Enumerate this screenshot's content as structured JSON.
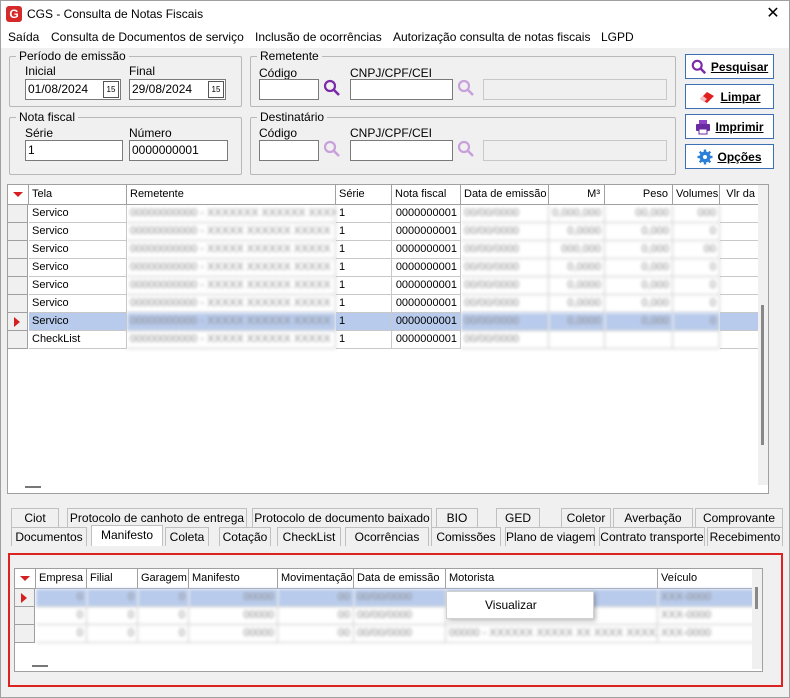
{
  "window": {
    "title": "CGS - Consulta de Notas Fiscais",
    "close": "✕",
    "icon": "G"
  },
  "menu": [
    "Saída",
    "Consulta de Documentos de serviço",
    "Inclusão de ocorrências",
    "Autorização consulta de notas fiscais",
    "LGPD"
  ],
  "periodo": {
    "title": "Período de emissão",
    "inicial_label": "Inicial",
    "inicial_value": "01/08/2024",
    "final_label": "Final",
    "final_value": "29/08/2024",
    "cal_text": "15"
  },
  "remetente": {
    "title": "Remetente",
    "codigo_label": "Código",
    "cnpj_label": "CNPJ/CPF/CEI"
  },
  "nota": {
    "title": "Nota fiscal",
    "serie_label": "Série",
    "serie_value": "1",
    "numero_label": "Número",
    "numero_value": "0000000001"
  },
  "destinatario": {
    "title": "Destinatário",
    "codigo_label": "Código",
    "cnpj_label": "CNPJ/CPF/CEI"
  },
  "buttons": {
    "pesquisar": "Pesquisar",
    "limpar": "Limpar",
    "imprimir": "Imprimir",
    "opcoes": "Opções"
  },
  "grid1": {
    "columns": [
      "Tela",
      "Remetente",
      "Série",
      "Nota fiscal",
      "Data de emissão",
      "M³",
      "Peso",
      "Volumes",
      "Vlr da"
    ],
    "rows": [
      {
        "tela": "Servico",
        "rem": "00000000000 - XXXXXXX XXXXXX XXXXX",
        "serie": "1",
        "nf": "0000000001",
        "data": "00/00/0000",
        "m3": "0,000,000",
        "peso": "00,000",
        "vol": "000"
      },
      {
        "tela": "Servico",
        "rem": "00000000000 - XXXXX XXXXXX XXXXX",
        "serie": "1",
        "nf": "0000000001",
        "data": "00/00/0000",
        "m3": "0,0000",
        "peso": "0,000",
        "vol": "0"
      },
      {
        "tela": "Servico",
        "rem": "00000000000 - XXXXX XXXXXX XXXXX",
        "serie": "1",
        "nf": "0000000001",
        "data": "00/00/0000",
        "m3": "000,000",
        "peso": "0,000",
        "vol": "00"
      },
      {
        "tela": "Servico",
        "rem": "00000000000 - XXXXX XXXXXX XXXXX",
        "serie": "1",
        "nf": "0000000001",
        "data": "00/00/0000",
        "m3": "0,0000",
        "peso": "0,000",
        "vol": "0"
      },
      {
        "tela": "Servico",
        "rem": "00000000000 - XXXXX XXXXXX XXXXX",
        "serie": "1",
        "nf": "0000000001",
        "data": "00/00/0000",
        "m3": "0,0000",
        "peso": "0,000",
        "vol": "0"
      },
      {
        "tela": "Servico",
        "rem": "00000000000 - XXXXX XXXXXX XXXXX",
        "serie": "1",
        "nf": "0000000001",
        "data": "00/00/0000",
        "m3": "0,0000",
        "peso": "0,000",
        "vol": "0"
      },
      {
        "tela": "Servico",
        "rem": "00000000000 - XXXXX XXXXXX XXXXX",
        "serie": "1",
        "nf": "0000000001",
        "data": "00/00/0000",
        "m3": "0,0000",
        "peso": "0,000",
        "vol": "0"
      },
      {
        "tela": "CheckList",
        "rem": "00000000000 - XXXXX XXXXXX XXXXX",
        "serie": "1",
        "nf": "0000000001",
        "data": "00/00/0000",
        "m3": "",
        "peso": "",
        "vol": ""
      }
    ],
    "selected_index": 6
  },
  "tabs_row1": [
    "Ciot",
    "Protocolo de canhoto de entrega",
    "Protocolo de documento baixado",
    "BIO",
    "GED",
    "Coletor",
    "Averbação",
    "Comprovante"
  ],
  "tabs_row2": [
    "Documentos",
    "Manifesto",
    "Coleta",
    "Cotação",
    "CheckList",
    "Ocorrências",
    "Comissões",
    "Plano de viagem",
    "Contrato transporte",
    "Recebimento"
  ],
  "active_tab": "Manifesto",
  "grid2": {
    "columns": [
      "Empresa",
      "Filial",
      "Garagem",
      "Manifesto",
      "Movimentação",
      "Data de emissão",
      "Motorista",
      "Veículo"
    ],
    "rows": [
      {
        "emp": "0",
        "fil": "0",
        "gar": "0",
        "man": "00000",
        "mov": "00",
        "data": "00/00/0000",
        "mot": "",
        "vei": "XXX-0000"
      },
      {
        "emp": "0",
        "fil": "0",
        "gar": "0",
        "man": "00000",
        "mov": "00",
        "data": "00/00/0000",
        "mot": "",
        "vei": "XXX-0000"
      },
      {
        "emp": "0",
        "fil": "0",
        "gar": "0",
        "man": "00000",
        "mov": "00",
        "data": "00/00/0000",
        "mot": "00000 - XXXXXX XXXXX XX XXXX XXXXX",
        "vei": "XXX-0000"
      }
    ]
  },
  "context_menu": {
    "item": "Visualizar"
  }
}
